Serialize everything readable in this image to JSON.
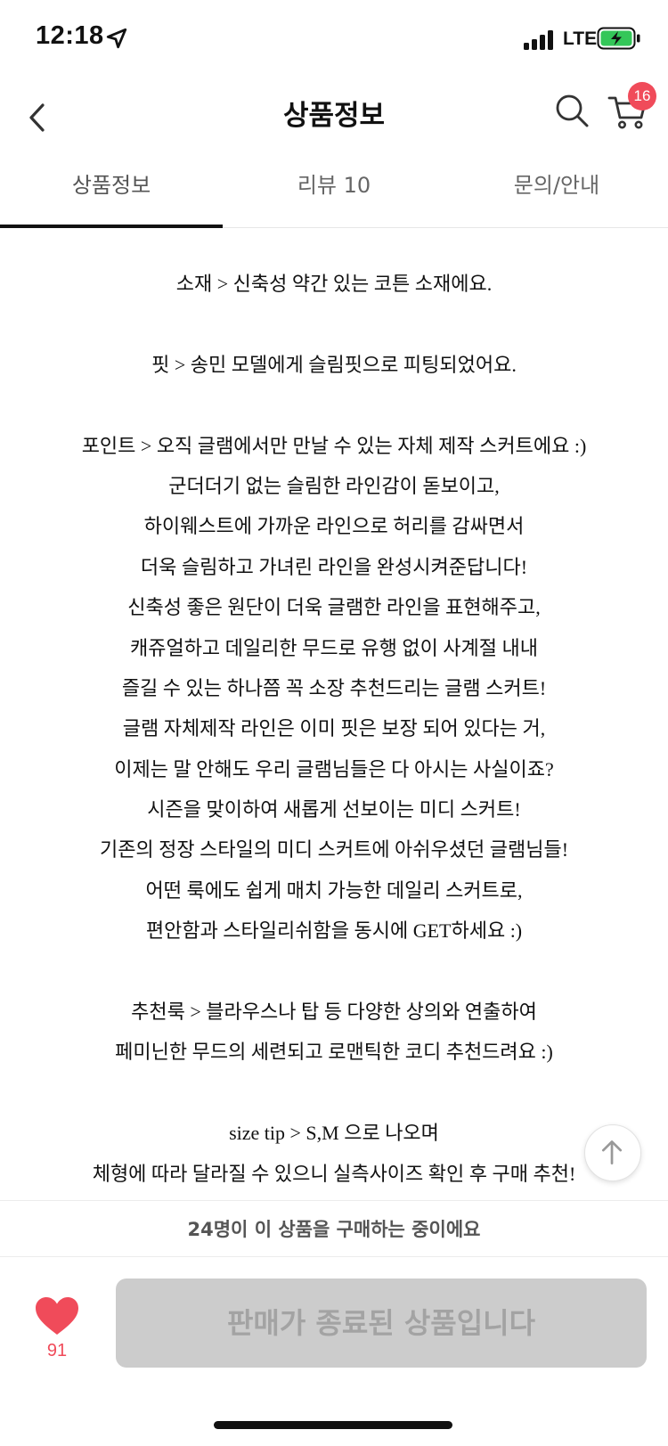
{
  "status_bar": {
    "time": "12:18",
    "network": "LTE"
  },
  "header": {
    "title": "상품정보",
    "cart_count": "16"
  },
  "tabs": [
    {
      "label": "상품정보",
      "active": true
    },
    {
      "label": "리뷰 10",
      "active": false
    },
    {
      "label": "문의/안내",
      "active": false
    }
  ],
  "description": {
    "lines": [
      "소재 > 신축성 약간 있는 코튼 소재에요.",
      "",
      "핏 > 송민 모델에게 슬림핏으로 피팅되었어요.",
      "",
      "포인트 > 오직 글램에서만 만날 수 있는 자체 제작 스커트에요 :)",
      "군더더기 없는 슬림한 라인감이 돋보이고,",
      "하이웨스트에 가까운 라인으로 허리를 감싸면서",
      "더욱 슬림하고 가녀린 라인을 완성시켜준답니다!",
      "신축성 좋은 원단이 더욱 글램한 라인을 표현해주고,",
      "캐쥬얼하고 데일리한 무드로 유행 없이 사계절 내내",
      "즐길 수 있는 하나쯤 꼭 소장 추천드리는 글램 스커트!",
      "글램 자체제작 라인은 이미 핏은 보장 되어 있다는 거,",
      "이제는 말 안해도 우리 글램님들은 다 아시는 사실이죠?",
      "시즌을 맞이하여 새롭게 선보이는 미디 스커트!",
      "기존의 정장 스타일의 미디 스커트에 아쉬우셨던 글램님들!",
      "어떤 룩에도 쉽게 매치 가능한 데일리 스커트로,",
      "편안함과 스타일리쉬함을 동시에 GET하세요 :)",
      "",
      "추천룩 > 블라우스나 탑 등 다양한 상의와 연출하여",
      "페미닌한 무드의 세련되고 로맨틱한 코디 추천드려요 :)",
      "",
      "size tip > S,M 으로 나오며",
      "체형에 따라 달라질 수 있으니 실측사이즈 확인 후 구매 추천!"
    ]
  },
  "buyers_notice": "24명이 이 상품을 구매하는 중이에요",
  "bottom": {
    "like_count": "91",
    "soldout_label": "판매가 종료된 상품입니다"
  },
  "colors": {
    "accent": "#f04b5a",
    "disabled_button": "#cccccc",
    "battery_green": "#34c759"
  },
  "icons": [
    "location-arrow-icon",
    "signal-icon",
    "battery-icon",
    "back-chevron-icon",
    "search-icon",
    "cart-icon",
    "arrow-up-icon",
    "heart-icon"
  ]
}
